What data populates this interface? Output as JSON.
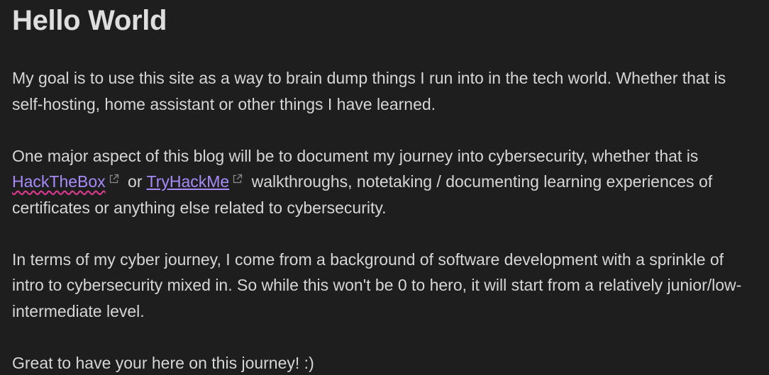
{
  "title": "Hello World",
  "paragraphs": {
    "p1": "My goal is to use this site as a way to brain dump things I run into in the tech world. Whether that is self-hosting, home assistant or other things I have learned.",
    "p2_before": "One major aspect of this blog will be to document my journey into cybersecurity, whether that is ",
    "p2_link1": "HackTheBox",
    "p2_between": " or ",
    "p2_link2": "TryHackMe",
    "p2_after": " walkthroughs, notetaking / documenting learning experiences of certificates or anything else related to cybersecurity.",
    "p3": "In terms of my cyber journey, I come from a background of software development with a sprinkle of intro to cybersecurity mixed in. So while this won't be 0 to hero, it will start from a relatively junior/low-intermediate level.",
    "p4": "Great to have your here on this journey! :)"
  },
  "colors": {
    "background": "#1e1e1e",
    "text": "#d6d6d6",
    "link": "#a78bfa",
    "spellcheck_underline": "#d33a8a"
  },
  "icons": {
    "external_link": "external-link-icon"
  }
}
